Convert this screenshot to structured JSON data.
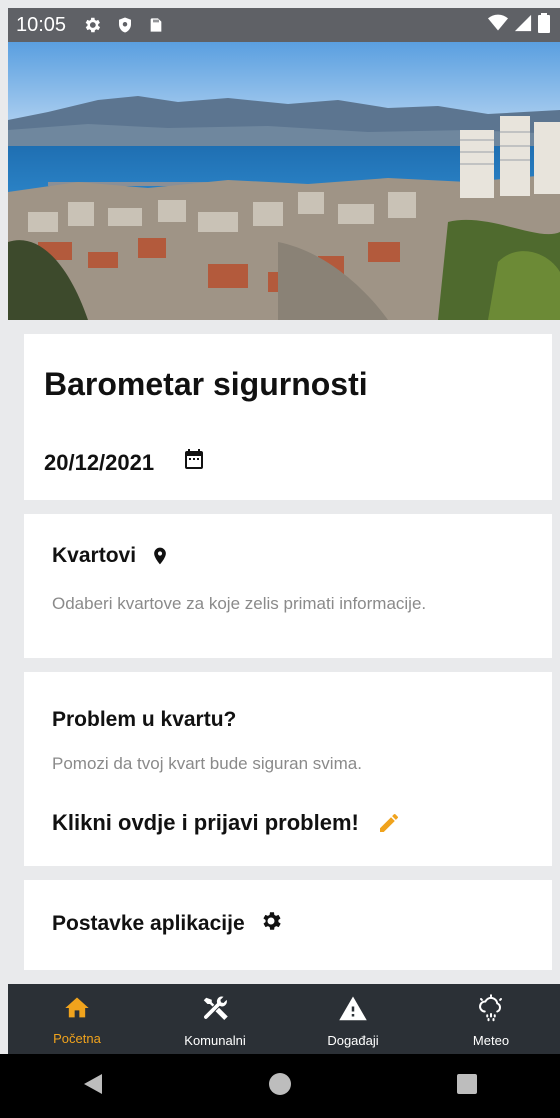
{
  "status": {
    "time": "10:05",
    "icons_left": [
      "settings-icon",
      "shield-icon",
      "sd-card-icon"
    ],
    "icons_right": [
      "wifi-icon",
      "signal-icon",
      "battery-icon"
    ]
  },
  "hero": {
    "image": "city-harbor-photo"
  },
  "header_card": {
    "title": "Barometar sigurnosti",
    "date": "20/12/2021",
    "date_icon": "calendar-icon"
  },
  "kvartovi_card": {
    "title": "Kvartovi",
    "title_icon": "location-pin-icon",
    "description": "Odaberi kvartove za koje zelis primati informacije."
  },
  "problem_card": {
    "title": "Problem u kvartu?",
    "description": "Pomozi da tvoj kvart bude siguran svima.",
    "cta_label": "Klikni ovdje i prijavi problem!",
    "cta_icon": "pencil-icon"
  },
  "settings_card": {
    "title": "Postavke aplikacije",
    "title_icon": "gear-icon"
  },
  "bottom_nav": {
    "items": [
      {
        "label": "Početna",
        "icon": "home-icon",
        "active": true
      },
      {
        "label": "Komunalni",
        "icon": "tools-icon",
        "active": false
      },
      {
        "label": "Događaji",
        "icon": "warning-icon",
        "active": false
      },
      {
        "label": "Meteo",
        "icon": "weather-icon",
        "active": false
      }
    ]
  },
  "colors": {
    "accent": "#f0a31d",
    "nav_background": "#2b3036",
    "page_background": "#e9eaec",
    "muted_text": "#8a8a8a"
  }
}
